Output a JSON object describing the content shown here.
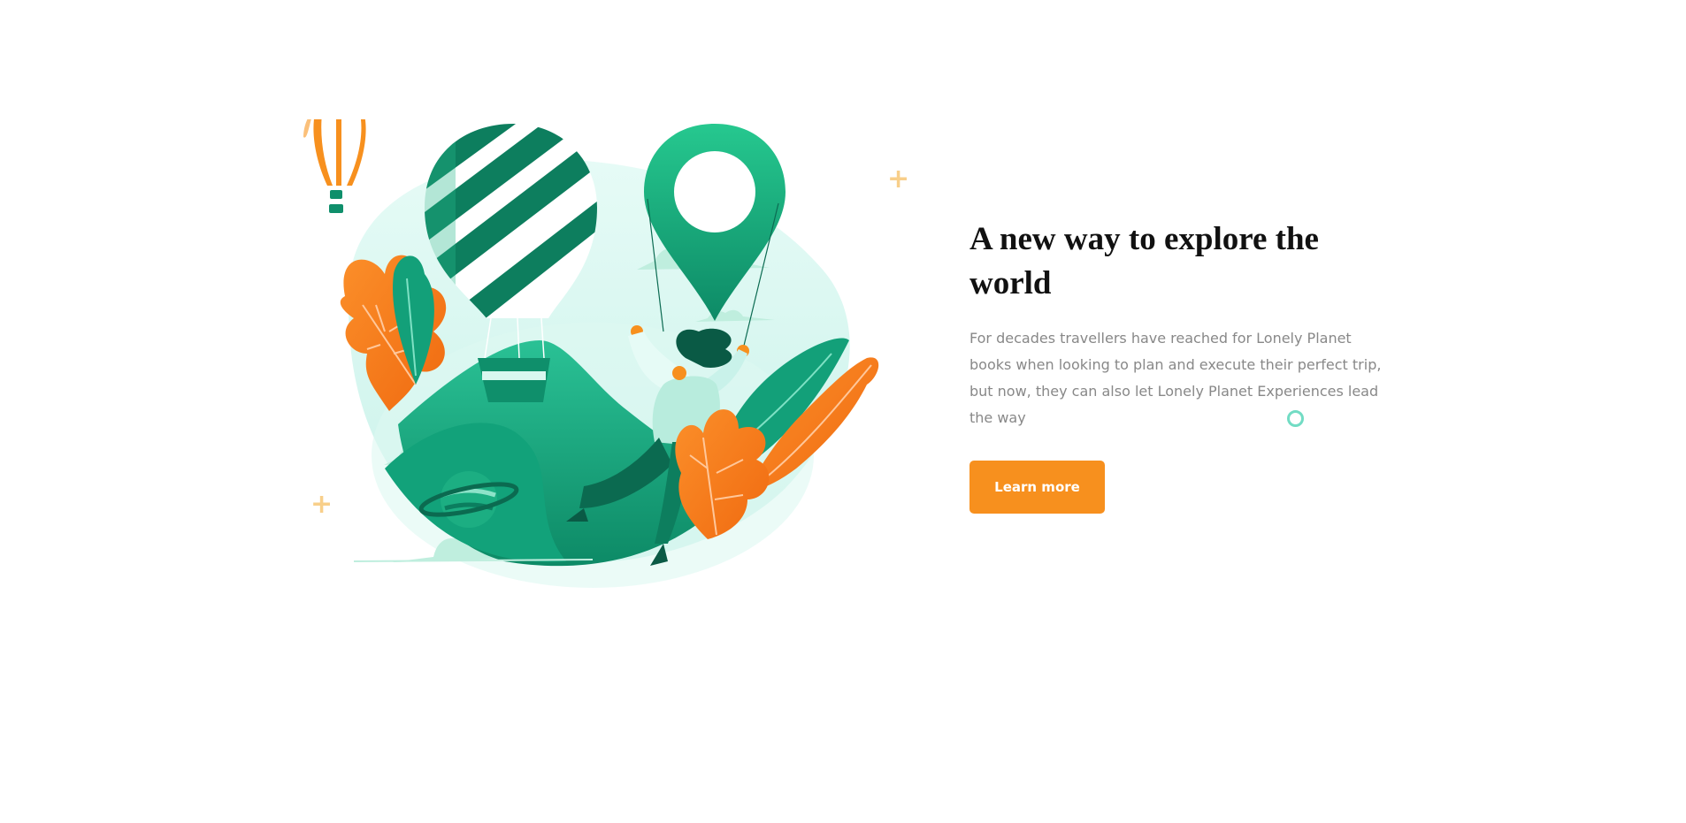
{
  "hero": {
    "title": "A new way to explore the world",
    "description": "For decades travellers have reached for Lonely Planet books when looking to plan and execute their perfect trip, but now, they can also let Lonely Planet Experiences lead the way",
    "cta_label": "Learn more"
  },
  "colors": {
    "accent": "#f7901e",
    "green": "#10a77a",
    "dark_green": "#0a6d53",
    "mint": "#d8f7ef",
    "heading": "#111111",
    "body_text": "#888888"
  },
  "icons": [
    "plus-icon",
    "ring-icon",
    "balloon-icon",
    "location-pin-icon"
  ]
}
